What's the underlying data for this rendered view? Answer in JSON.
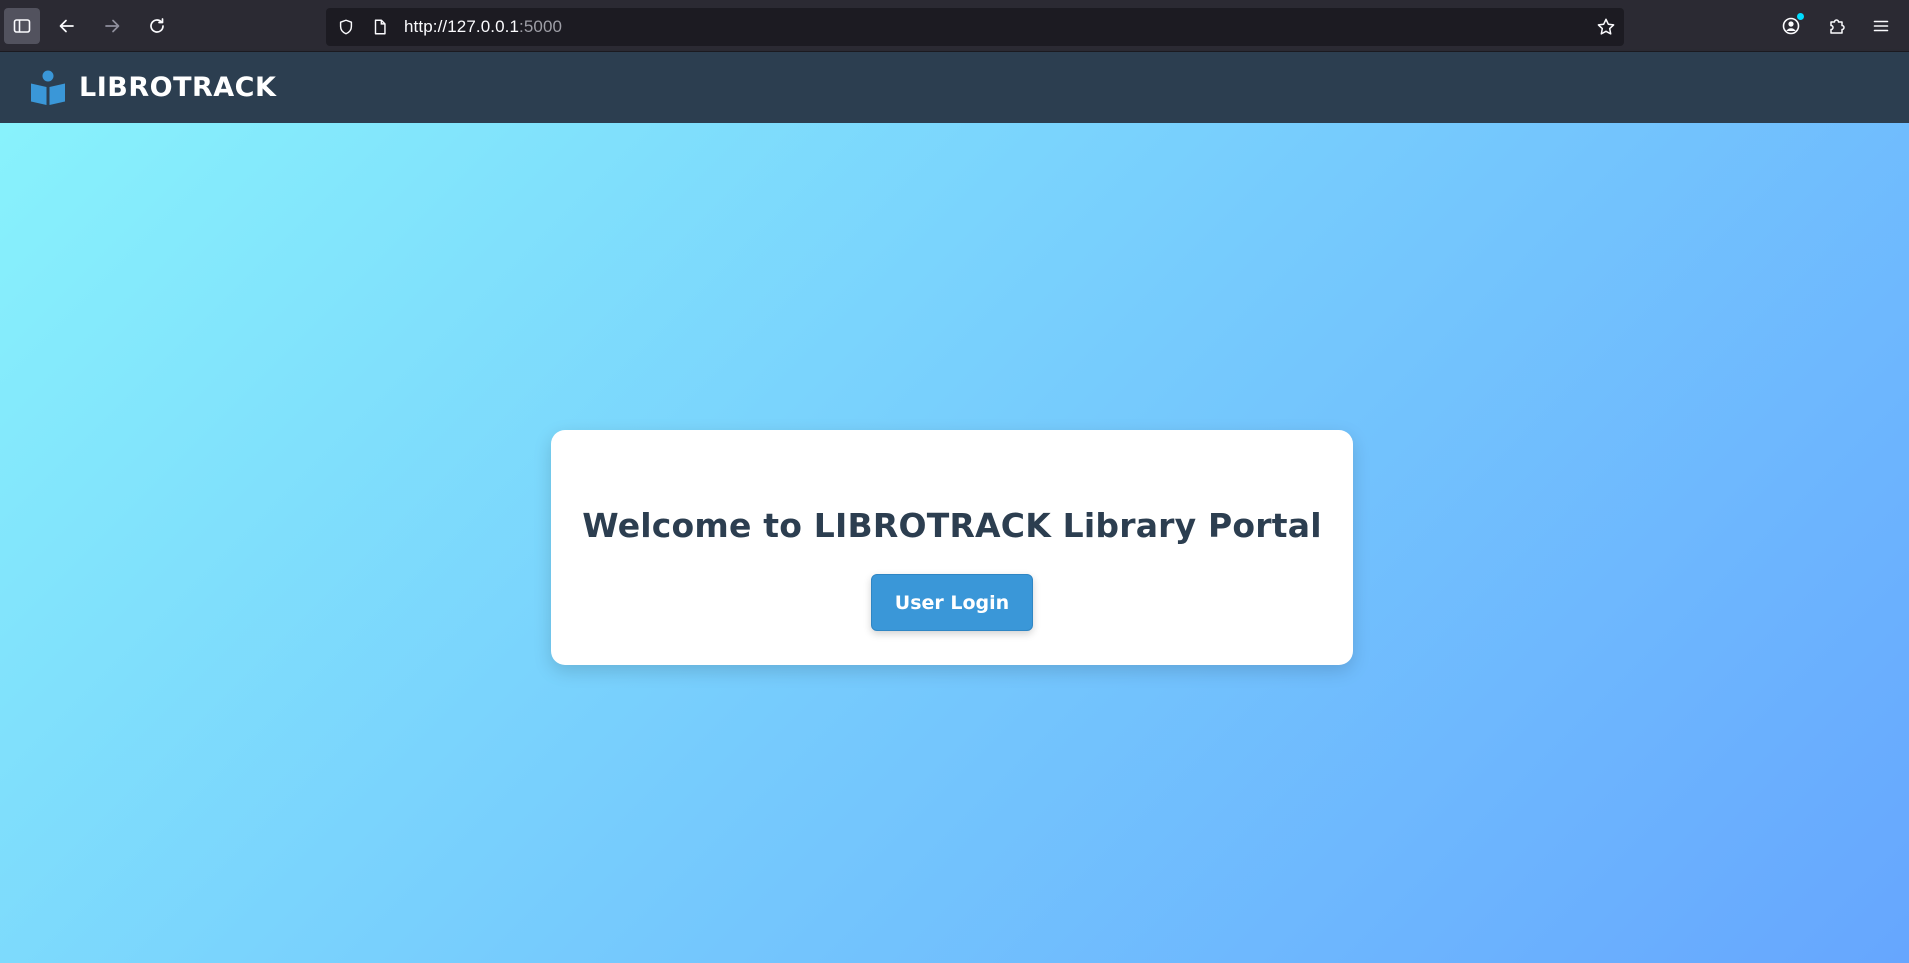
{
  "browser": {
    "url_host": "http://127.0.0.1",
    "url_port": ":5000"
  },
  "header": {
    "brand_name": "LIBROTRACK",
    "brand_color": "#3a97d8",
    "background": "#2c3e50"
  },
  "main": {
    "title": "Welcome to LIBROTRACK Library Portal",
    "login_button": "User Login",
    "gradient": [
      "#88f2fc",
      "#76cbfd",
      "#66a6fe"
    ]
  },
  "icons": {
    "sidebar": "sidebar-icon",
    "back": "back-arrow-icon",
    "forward": "forward-arrow-icon",
    "reload": "reload-icon",
    "shield": "shield-icon",
    "page": "page-icon",
    "bookmark": "star-icon",
    "account": "account-icon",
    "extensions": "puzzle-icon",
    "menu": "hamburger-menu-icon",
    "brand": "book-reader-icon"
  }
}
